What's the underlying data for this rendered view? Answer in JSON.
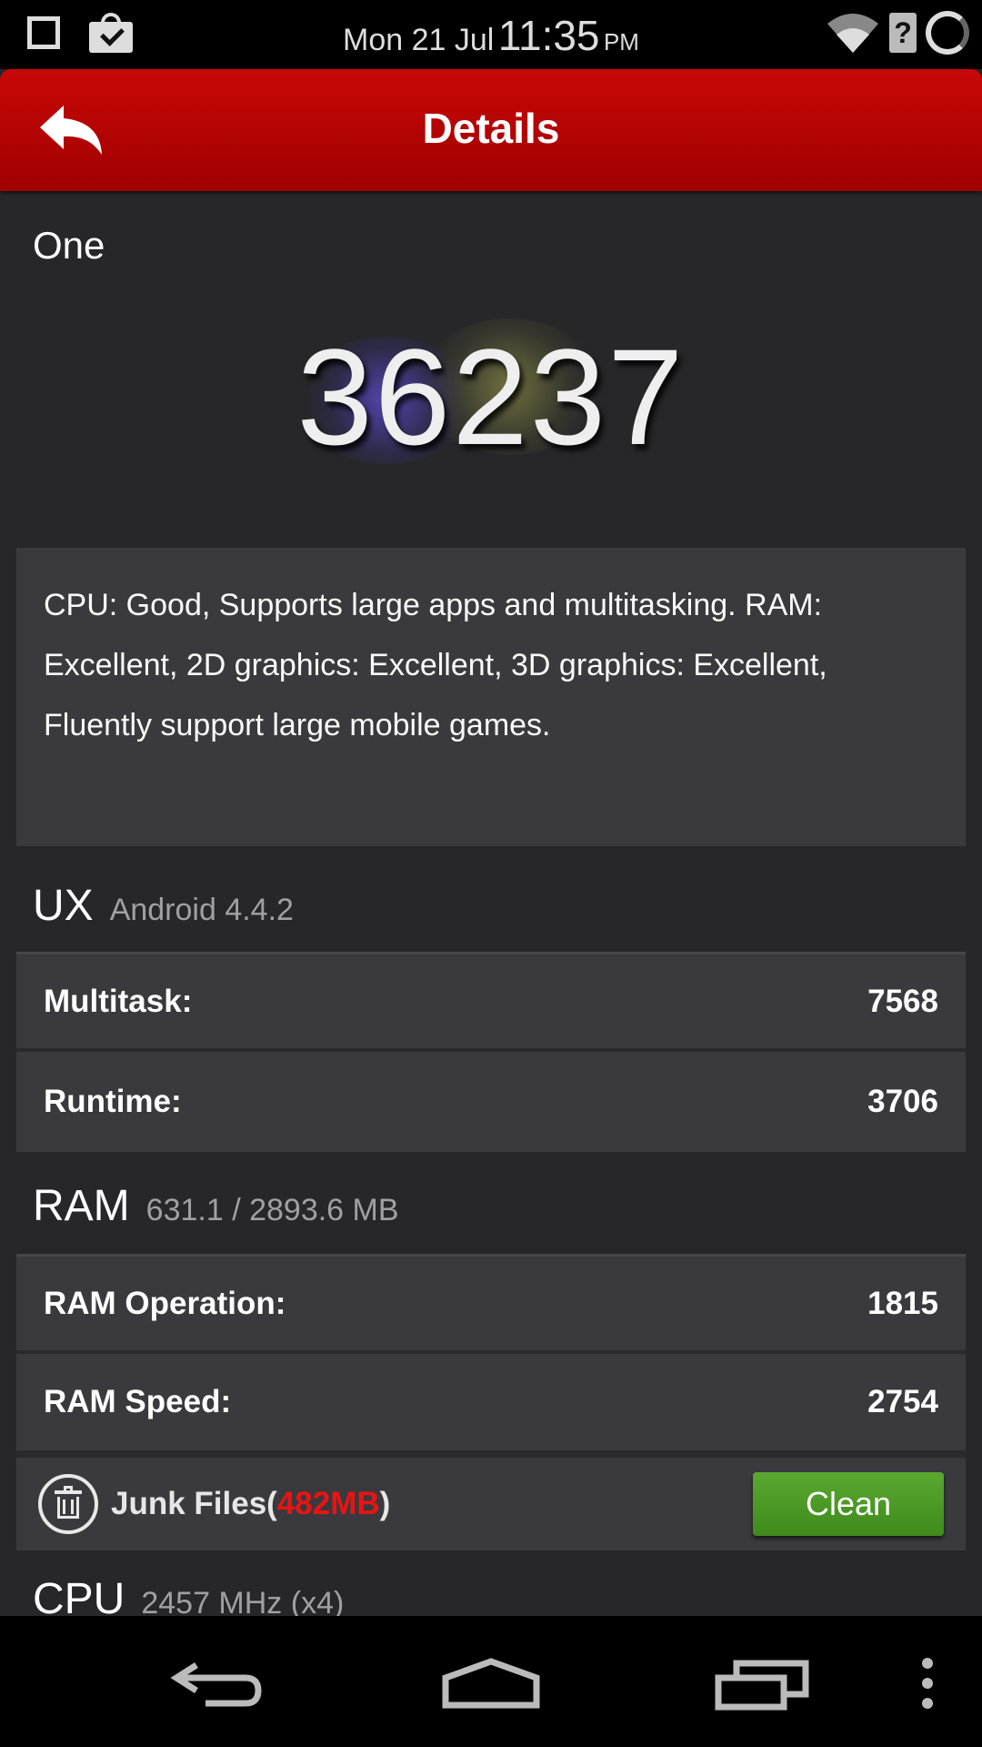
{
  "status_bar": {
    "date": "Mon 21 Jul",
    "time": "11:35",
    "ampm": "PM"
  },
  "header": {
    "title": "Details"
  },
  "device_name": "One",
  "score": "36237",
  "description": "CPU: Good, Supports large apps and multitasking. RAM: Excellent, 2D graphics: Excellent, 3D graphics: Excellent, Fluently support large mobile games.",
  "ux": {
    "name": "UX",
    "sub": "Android 4.4.2",
    "rows": [
      {
        "label": "Multitask:",
        "value": "7568"
      },
      {
        "label": "Runtime:",
        "value": "3706"
      }
    ]
  },
  "ram": {
    "name": "RAM",
    "sub": "631.1 / 2893.6 MB",
    "rows": [
      {
        "label": "RAM Operation:",
        "value": "1815"
      },
      {
        "label": "RAM Speed:",
        "value": "2754"
      }
    ],
    "junk": {
      "prefix": "Junk Files(",
      "size": "482MB",
      "suffix": ")",
      "button": "Clean",
      "size_color": "#e81414",
      "button_color": "#4f9a26"
    }
  },
  "cpu": {
    "name": "CPU",
    "sub": "2457 MHz (x4)"
  },
  "colors": {
    "header": "#b80404",
    "background": "#27272a",
    "card": "#3a3a3e"
  },
  "icons": [
    "square-icon",
    "shopping-bag-check-icon",
    "wifi-icon",
    "unknown-sim-icon",
    "loading-ring-icon",
    "back-arrow-icon",
    "trash-icon",
    "nav-back-icon",
    "nav-home-icon",
    "nav-recents-icon",
    "overflow-menu-icon"
  ]
}
